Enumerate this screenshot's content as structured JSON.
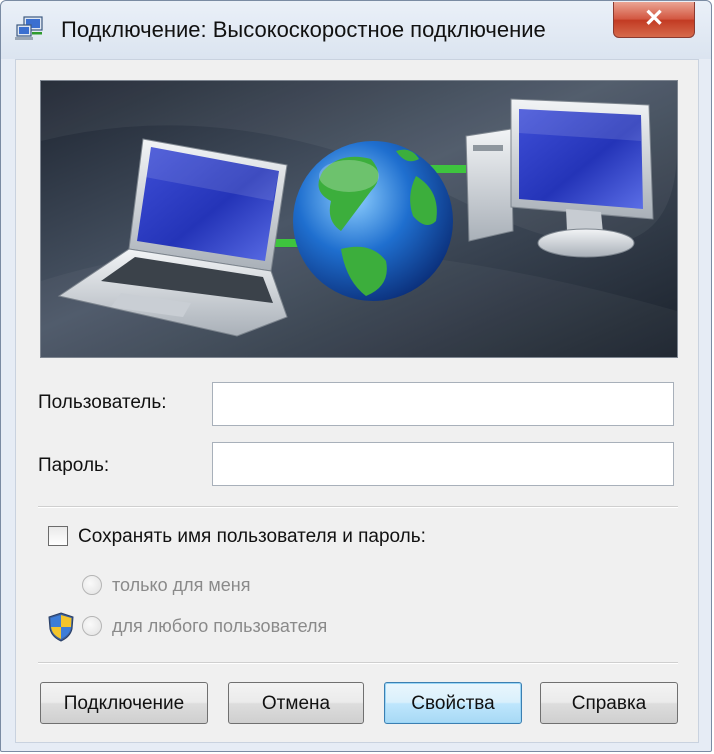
{
  "window": {
    "title": "Подключение: Высокоскоростное подключение",
    "close_symbol": "✕"
  },
  "banner": {
    "icons": [
      "laptop-icon",
      "globe-icon",
      "desktop-computer-icon"
    ],
    "accent_green": "#3ec43e",
    "background": "#2a3442"
  },
  "form": {
    "user_label": "Пользователь:",
    "user_value": "",
    "password_label": "Пароль:",
    "password_value": ""
  },
  "save_credentials": {
    "label": "Сохранять имя пользователя и пароль:",
    "checked": false,
    "options": [
      {
        "label": "только для меня",
        "selected": false,
        "enabled": false
      },
      {
        "label": "для любого пользователя",
        "selected": false,
        "enabled": false,
        "icon": "uac-shield-icon"
      }
    ]
  },
  "buttons": {
    "connect": "Подключение",
    "cancel": "Отмена",
    "properties": "Свойства",
    "help": "Справка"
  }
}
